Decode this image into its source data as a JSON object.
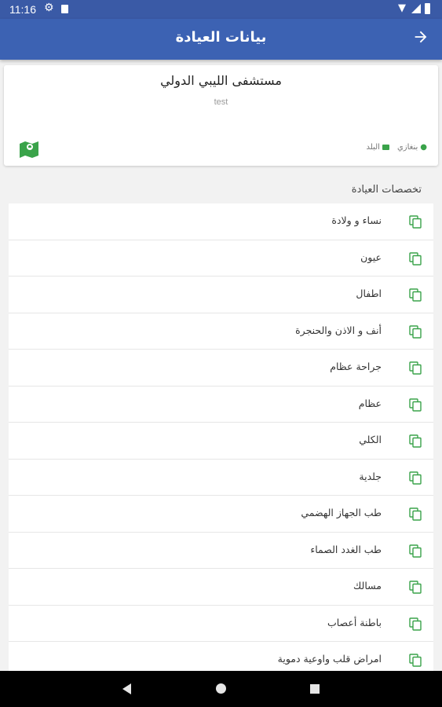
{
  "status_bar": {
    "time": "11:16",
    "icons": [
      "settings-icon",
      "sd-card-icon",
      "wifi-icon",
      "signal-icon",
      "battery-icon"
    ]
  },
  "app_bar": {
    "title": "بيانات العيادة",
    "back_icon": "arrow-forward-icon",
    "color": "#3c62b3"
  },
  "clinic": {
    "name": "مستشفى الليبي الدولي",
    "subtitle": "test",
    "city": "بنغازي",
    "category": "البلد",
    "map_icon": "map-icon",
    "accent": "#3aa34a"
  },
  "specialties": {
    "title": "تخصصات العيادة",
    "items": [
      {
        "label": "نساء و ولادة"
      },
      {
        "label": "عيون"
      },
      {
        "label": "اطفال"
      },
      {
        "label": "أنف و الاذن والحنجرة"
      },
      {
        "label": "جراحة عظام"
      },
      {
        "label": "عظام"
      },
      {
        "label": "الكلي"
      },
      {
        "label": "جلدية"
      },
      {
        "label": "طب الجهاز الهضمي"
      },
      {
        "label": "طب الغدد الصماء"
      },
      {
        "label": "مسالك"
      },
      {
        "label": "باطنة أعصاب"
      },
      {
        "label": "امراض قلب واوعية دموية"
      }
    ]
  },
  "nav_bar": {
    "icons": [
      "back-triangle-icon",
      "home-circle-icon",
      "recents-square-icon"
    ]
  }
}
